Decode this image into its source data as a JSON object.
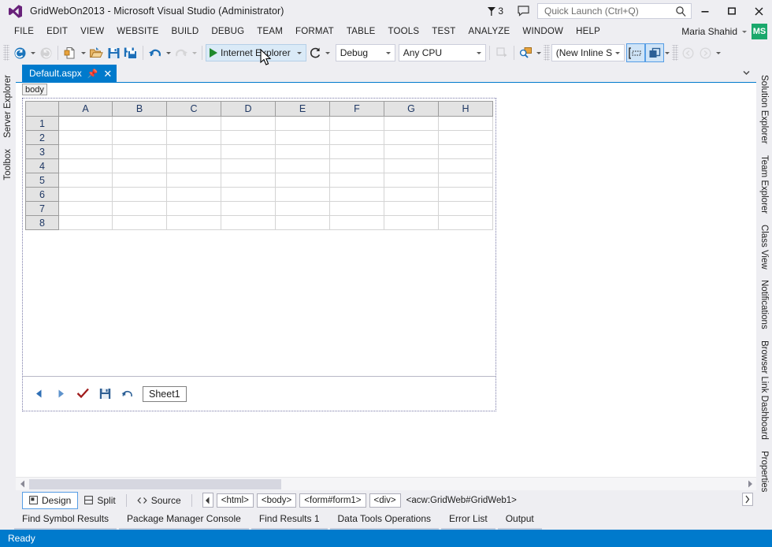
{
  "window": {
    "title": "GridWebOn2013 - Microsoft Visual Studio (Administrator)",
    "logo_icon": "visual-studio-logo",
    "notification_count": "3",
    "notification_icon": "flag-icon",
    "feedback_icon": "feedback-speech-bubble-icon",
    "minimize_icon": "minimize-icon",
    "maximize_icon": "maximize-icon",
    "close_icon": "close-icon"
  },
  "quick_launch": {
    "placeholder": "Quick Launch (Ctrl+Q)",
    "value": "",
    "search_icon": "search-magnifier-icon"
  },
  "menu": {
    "items": [
      {
        "label": "FILE"
      },
      {
        "label": "EDIT"
      },
      {
        "label": "VIEW"
      },
      {
        "label": "WEBSITE"
      },
      {
        "label": "BUILD"
      },
      {
        "label": "DEBUG"
      },
      {
        "label": "TEAM"
      },
      {
        "label": "FORMAT"
      },
      {
        "label": "TABLE"
      },
      {
        "label": "TOOLS"
      },
      {
        "label": "TEST"
      },
      {
        "label": "ANALYZE"
      },
      {
        "label": "WINDOW"
      },
      {
        "label": "HELP"
      }
    ],
    "user_name": "Maria Shahid",
    "user_initials": "MS",
    "user_avatar_color": "#1aa86c"
  },
  "toolbar": {
    "nav_back_icon": "navigate-back-icon",
    "nav_forward_icon": "navigate-forward-icon",
    "new_item_icon": "new-item-icon",
    "open_icon": "open-folder-icon",
    "save_icon": "save-icon",
    "save_all_icon": "save-all-icon",
    "undo_icon": "undo-arrow-icon",
    "redo_icon": "redo-arrow-icon",
    "run_label": "Internet Explorer",
    "run_play_icon": "play-triangle-icon",
    "refresh_icon": "refresh-circular-arrow-icon",
    "configuration": "Debug",
    "platform": "Any CPU",
    "step_icon": "step-into-icon",
    "find_icon": "find-in-files-icon",
    "style_value": "(New Inline Style",
    "style_apply_icon": "style-selection-icon",
    "style_attach_icon": "attach-style-sheet-icon",
    "back_nav_icon": "back-circle-icon",
    "fwd_nav_icon": "forward-circle-icon"
  },
  "left_sidebar": {
    "items": [
      {
        "label": "Server Explorer"
      },
      {
        "label": "Toolbox"
      }
    ]
  },
  "right_sidebar": {
    "items": [
      {
        "label": "Solution Explorer"
      },
      {
        "label": "Team Explorer"
      },
      {
        "label": "Class View"
      },
      {
        "label": "Notifications"
      },
      {
        "label": "Browser Link Dashboard"
      },
      {
        "label": "Properties"
      }
    ]
  },
  "document": {
    "tab_label": "Default.aspx",
    "pin_icon": "pin-icon",
    "close_icon": "close-icon",
    "tab_menu_icon": "tab-dropdown-icon",
    "tag_selector": "body",
    "accent_color": "#007acc"
  },
  "grid_control": {
    "columns": [
      "A",
      "B",
      "C",
      "D",
      "E",
      "F",
      "G",
      "H"
    ],
    "rows": [
      "1",
      "2",
      "3",
      "4",
      "5",
      "6",
      "7",
      "8"
    ],
    "cells": [
      [
        "",
        "",
        "",
        "",
        "",
        "",
        "",
        ""
      ],
      [
        "",
        "",
        "",
        "",
        "",
        "",
        "",
        ""
      ],
      [
        "",
        "",
        "",
        "",
        "",
        "",
        "",
        ""
      ],
      [
        "",
        "",
        "",
        "",
        "",
        "",
        "",
        ""
      ],
      [
        "",
        "",
        "",
        "",
        "",
        "",
        "",
        ""
      ],
      [
        "",
        "",
        "",
        "",
        "",
        "",
        "",
        ""
      ],
      [
        "",
        "",
        "",
        "",
        "",
        "",
        "",
        ""
      ],
      [
        "",
        "",
        "",
        "",
        "",
        "",
        "",
        ""
      ]
    ],
    "header_text_color": "#1f3864",
    "header_bg_color": "#e3e3e3",
    "sheet_toolbar": {
      "prev_icon": "previous-sheet-triangle-icon",
      "next_icon": "next-sheet-triangle-icon",
      "submit_icon": "checkmark-icon",
      "save_icon": "floppy-save-icon",
      "undo_icon": "undo-arrow-icon",
      "sheet_name": "Sheet1"
    }
  },
  "view_tabs": {
    "design_label": "Design",
    "design_icon": "design-view-icon",
    "split_label": "Split",
    "split_icon": "split-view-icon",
    "source_label": "Source",
    "source_icon": "source-code-icon",
    "nav_left_icon": "breadcrumb-scroll-left-icon",
    "expand_icon": "expand-breadcrumb-icon",
    "breadcrumbs": [
      {
        "label": "<html>",
        "boxed": true
      },
      {
        "label": "<body>",
        "boxed": true
      },
      {
        "label": "<form#form1>",
        "boxed": true
      },
      {
        "label": "<div>",
        "boxed": true
      },
      {
        "label": "<acw:GridWeb#GridWeb1>",
        "boxed": false
      }
    ]
  },
  "bottom_panel": {
    "tabs": [
      {
        "label": "Find Symbol Results"
      },
      {
        "label": "Package Manager Console"
      },
      {
        "label": "Find Results 1"
      },
      {
        "label": "Data Tools Operations"
      },
      {
        "label": "Error List"
      },
      {
        "label": "Output"
      }
    ]
  },
  "status_bar": {
    "message": "Ready",
    "bg_color": "#007acc"
  }
}
